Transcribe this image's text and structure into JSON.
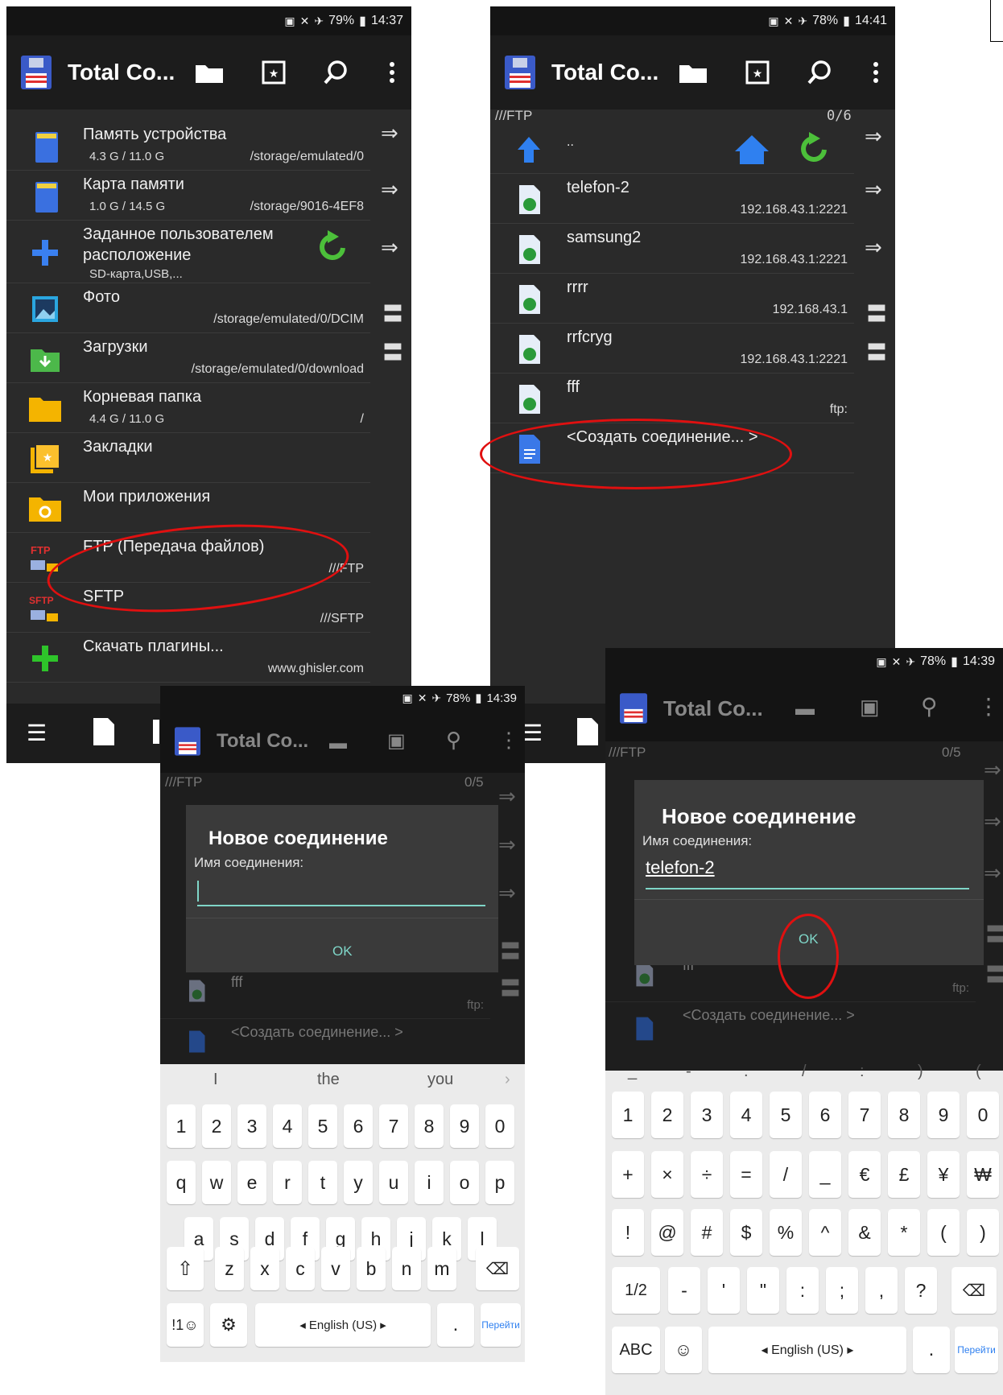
{
  "screen1": {
    "status": {
      "battery": "79%",
      "time": "14:37"
    },
    "appbar": {
      "title": "Total Co..."
    },
    "items": [
      {
        "name": "Память устройства",
        "sub": "4.3 G / 11.0 G",
        "path": "/storage/emulated/0"
      },
      {
        "name": "Карта памяти",
        "sub": "1.0 G / 14.5 G",
        "path": "/storage/9016-4EF8"
      },
      {
        "name": "Заданное пользователем",
        "name2": "расположение",
        "sub": "SD-карта,USB,..."
      },
      {
        "name": "Фото",
        "path": "/storage/emulated/0/DCIM"
      },
      {
        "name": "Загрузки",
        "path": "/storage/emulated/0/download"
      },
      {
        "name": "Корневая папка",
        "sub": "4.4 G / 11.0 G",
        "path": "/"
      },
      {
        "name": "Закладки"
      },
      {
        "name": "Мои приложения"
      },
      {
        "name": "FTP (Передача файлов)",
        "path": "///FTP"
      },
      {
        "name": "SFTP",
        "path": "///SFTP"
      },
      {
        "name": "Скачать плагины...",
        "path": "www.ghisler.com"
      }
    ]
  },
  "screen2": {
    "status": {
      "battery": "78%",
      "time": "14:41"
    },
    "appbar": {
      "title": "Total Co..."
    },
    "path": "///FTP",
    "count": "0/6",
    "up": "..",
    "items": [
      {
        "name": "telefon-2",
        "addr": "192.168.43.1:2221"
      },
      {
        "name": "samsung2",
        "addr": "192.168.43.1:2221"
      },
      {
        "name": "rrrr",
        "addr": "192.168.43.1"
      },
      {
        "name": "rrfcryg",
        "addr": "192.168.43.1:2221"
      },
      {
        "name": "fff",
        "addr": "ftp:"
      },
      {
        "name": "<Создать соединение... >"
      }
    ]
  },
  "screen3": {
    "status": {
      "battery": "78%",
      "time": "14:39"
    },
    "appbar": {
      "title": "Total Co..."
    },
    "path": "///FTP",
    "count": "0/5",
    "dialog": {
      "title": "Новое соединение",
      "label": "Имя соединения:",
      "value": "",
      "ok": "OK"
    },
    "bg_items": [
      {
        "name": "fff",
        "addr": "ftp:"
      },
      {
        "name": "<Создать соединение... >"
      }
    ],
    "suggestions": [
      "I",
      "the",
      "you"
    ],
    "keys_numbers": [
      "1",
      "2",
      "3",
      "4",
      "5",
      "6",
      "7",
      "8",
      "9",
      "0"
    ],
    "keys_row1": [
      "q",
      "w",
      "e",
      "r",
      "t",
      "y",
      "u",
      "i",
      "o",
      "p"
    ],
    "keys_row2": [
      "a",
      "s",
      "d",
      "f",
      "g",
      "h",
      "j",
      "k",
      "l"
    ],
    "keys_row3": [
      "z",
      "x",
      "c",
      "v",
      "b",
      "n",
      "m"
    ],
    "sym_key": "!1☺",
    "lang": "◂ English (US) ▸",
    "go": "Перейти",
    "dot": "."
  },
  "screen4": {
    "status": {
      "battery": "78%",
      "time": "14:39"
    },
    "appbar": {
      "title": "Total Co..."
    },
    "path": "///FTP",
    "count": "0/5",
    "dialog": {
      "title": "Новое соединение",
      "label": "Имя соединения:",
      "value": "telefon-2",
      "ok": "OK"
    },
    "bg_items": [
      {
        "name": "fff",
        "addr": "ftp:"
      },
      {
        "name": "<Создать соединение... >"
      }
    ],
    "suggestions": [
      "_",
      "-",
      ".",
      "/",
      ":",
      ")",
      "("
    ],
    "keys_numbers": [
      "1",
      "2",
      "3",
      "4",
      "5",
      "6",
      "7",
      "8",
      "9",
      "0"
    ],
    "keys_row1": [
      "+",
      "×",
      "÷",
      "=",
      "/",
      "_",
      "€",
      "£",
      "¥",
      "₩"
    ],
    "keys_row2": [
      "!",
      "@",
      "#",
      "$",
      "%",
      "^",
      "&",
      "*",
      "(",
      ")"
    ],
    "keys_row3": [
      "-",
      "'",
      "\"",
      ":",
      ";",
      ",",
      "?"
    ],
    "page_key": "1/2",
    "abc_key": "ABC",
    "lang": "◂ English (US) ▸",
    "go": "Перейти",
    "dot": "."
  },
  "colors": {
    "annotation": "#e01010",
    "accent": "#7fd6c8",
    "panel": "#2a2a2a"
  }
}
